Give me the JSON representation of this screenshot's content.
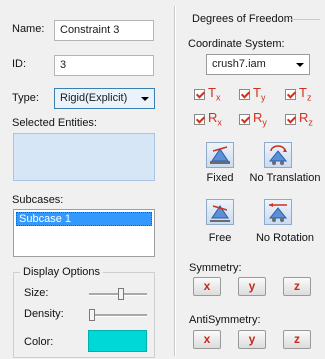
{
  "left": {
    "name_label": "Name:",
    "name_value": "Constraint 3",
    "id_label": "ID:",
    "id_value": "3",
    "type_label": "Type:",
    "type_value": "Rigid(Explicit)",
    "selected_entities_label": "Selected Entities:",
    "subcases_label": "Subcases:",
    "subcases": [
      "Subcase 1"
    ],
    "display_options": {
      "title": "Display Options",
      "size_label": "Size:",
      "size_level": 0.55,
      "density_label": "Density:",
      "density_level": 0.0,
      "color_label": "Color:",
      "color_value": "#00d8d8"
    }
  },
  "right": {
    "title": "Degrees of Freedom",
    "coord_label": "Coordinate System:",
    "coord_value": "crush7.iam",
    "dof": [
      {
        "letter": "T",
        "sub": "x",
        "checked": true
      },
      {
        "letter": "T",
        "sub": "y",
        "checked": true
      },
      {
        "letter": "T",
        "sub": "z",
        "checked": true
      },
      {
        "letter": "R",
        "sub": "x",
        "checked": true
      },
      {
        "letter": "R",
        "sub": "y",
        "checked": true
      },
      {
        "letter": "R",
        "sub": "z",
        "checked": true
      }
    ],
    "presets": [
      {
        "label": "Fixed",
        "icon": "fixed-support-icon"
      },
      {
        "label": "No Translation",
        "icon": "no-translation-icon"
      },
      {
        "label": "Free",
        "icon": "free-support-icon"
      },
      {
        "label": "No Rotation",
        "icon": "no-rotation-icon"
      }
    ],
    "symmetry_label": "Symmetry:",
    "symmetry_buttons": [
      "x",
      "y",
      "z"
    ],
    "antisymmetry_label": "AntiSymmetry:",
    "antisymmetry_buttons": [
      "x",
      "y",
      "z"
    ]
  },
  "colors": {
    "accent_red": "#d0311e",
    "selection_blue": "#3399ff",
    "entities_fill": "#d6e6f7"
  }
}
